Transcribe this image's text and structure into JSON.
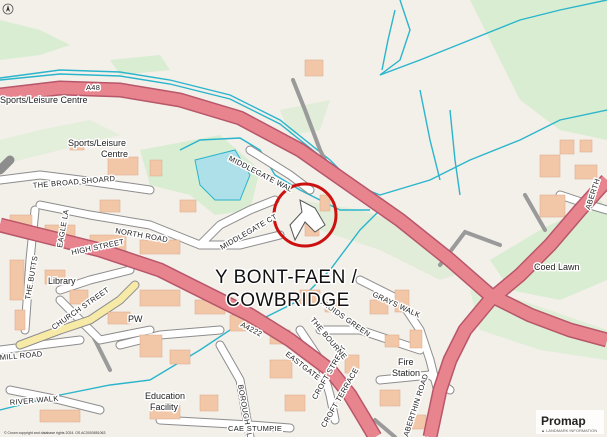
{
  "map": {
    "town_name_line1": "Y BONT-FAEN /",
    "town_name_line2": "COWBRIDGE",
    "road_a48": "A48",
    "road_a4222": "A4222",
    "places": {
      "sports_centre_top": "Sports/Leisure Centre",
      "sports_centre_line1": "Sports/Leisure",
      "sports_centre_line2": "Centre",
      "library": "Library",
      "pw": "PW",
      "fire_station_line1": "Fire",
      "fire_station_line2": "Station",
      "education_line1": "Education",
      "education_line2": "Facility",
      "coed_lawn": "Coed Lawn"
    },
    "streets": {
      "the_broad_shoard": "THE BROAD SHOARD",
      "north_road": "NORTH ROAD",
      "middlegate_wal": "MIDDLEGATE WAL",
      "middlegate_ct": "MIDDLEGATE CT",
      "the_butts": "THE BUTTS",
      "eagle_la": "EAGLE LA",
      "high_street": "HIGH STREET",
      "church_street": "CHURCH STREET",
      "mill_road": "MILL ROAD",
      "river_walk": "RIVER WALK",
      "eastgate": "EASTGATE",
      "borough_cl": "BOROUGH CL",
      "cae_stumpie": "CAE STUMPIE",
      "croft_street": "CROFT STREET",
      "croft_terrace": "CROFT TERRACE",
      "druids_green": "DRUIDS GREEN",
      "the_bourne": "THE BOURNE",
      "grays_walk": "GRAYS WALK",
      "aberthin_road": "ABERTHIN ROAD",
      "aberthin_top": "ABERTH"
    },
    "copyright": "© Crown copyright and database rights 2024. OS AC0000851063",
    "brand": "Promap",
    "brand_sub": "▲ LANDMARK INFORMATION",
    "colors": {
      "background": "#f3efe9",
      "green": "#d6ebcf",
      "road_pink": "#e8848d",
      "river": "#2ab5cc",
      "building": "#f2c7a8",
      "circle": "#cc1111"
    }
  }
}
